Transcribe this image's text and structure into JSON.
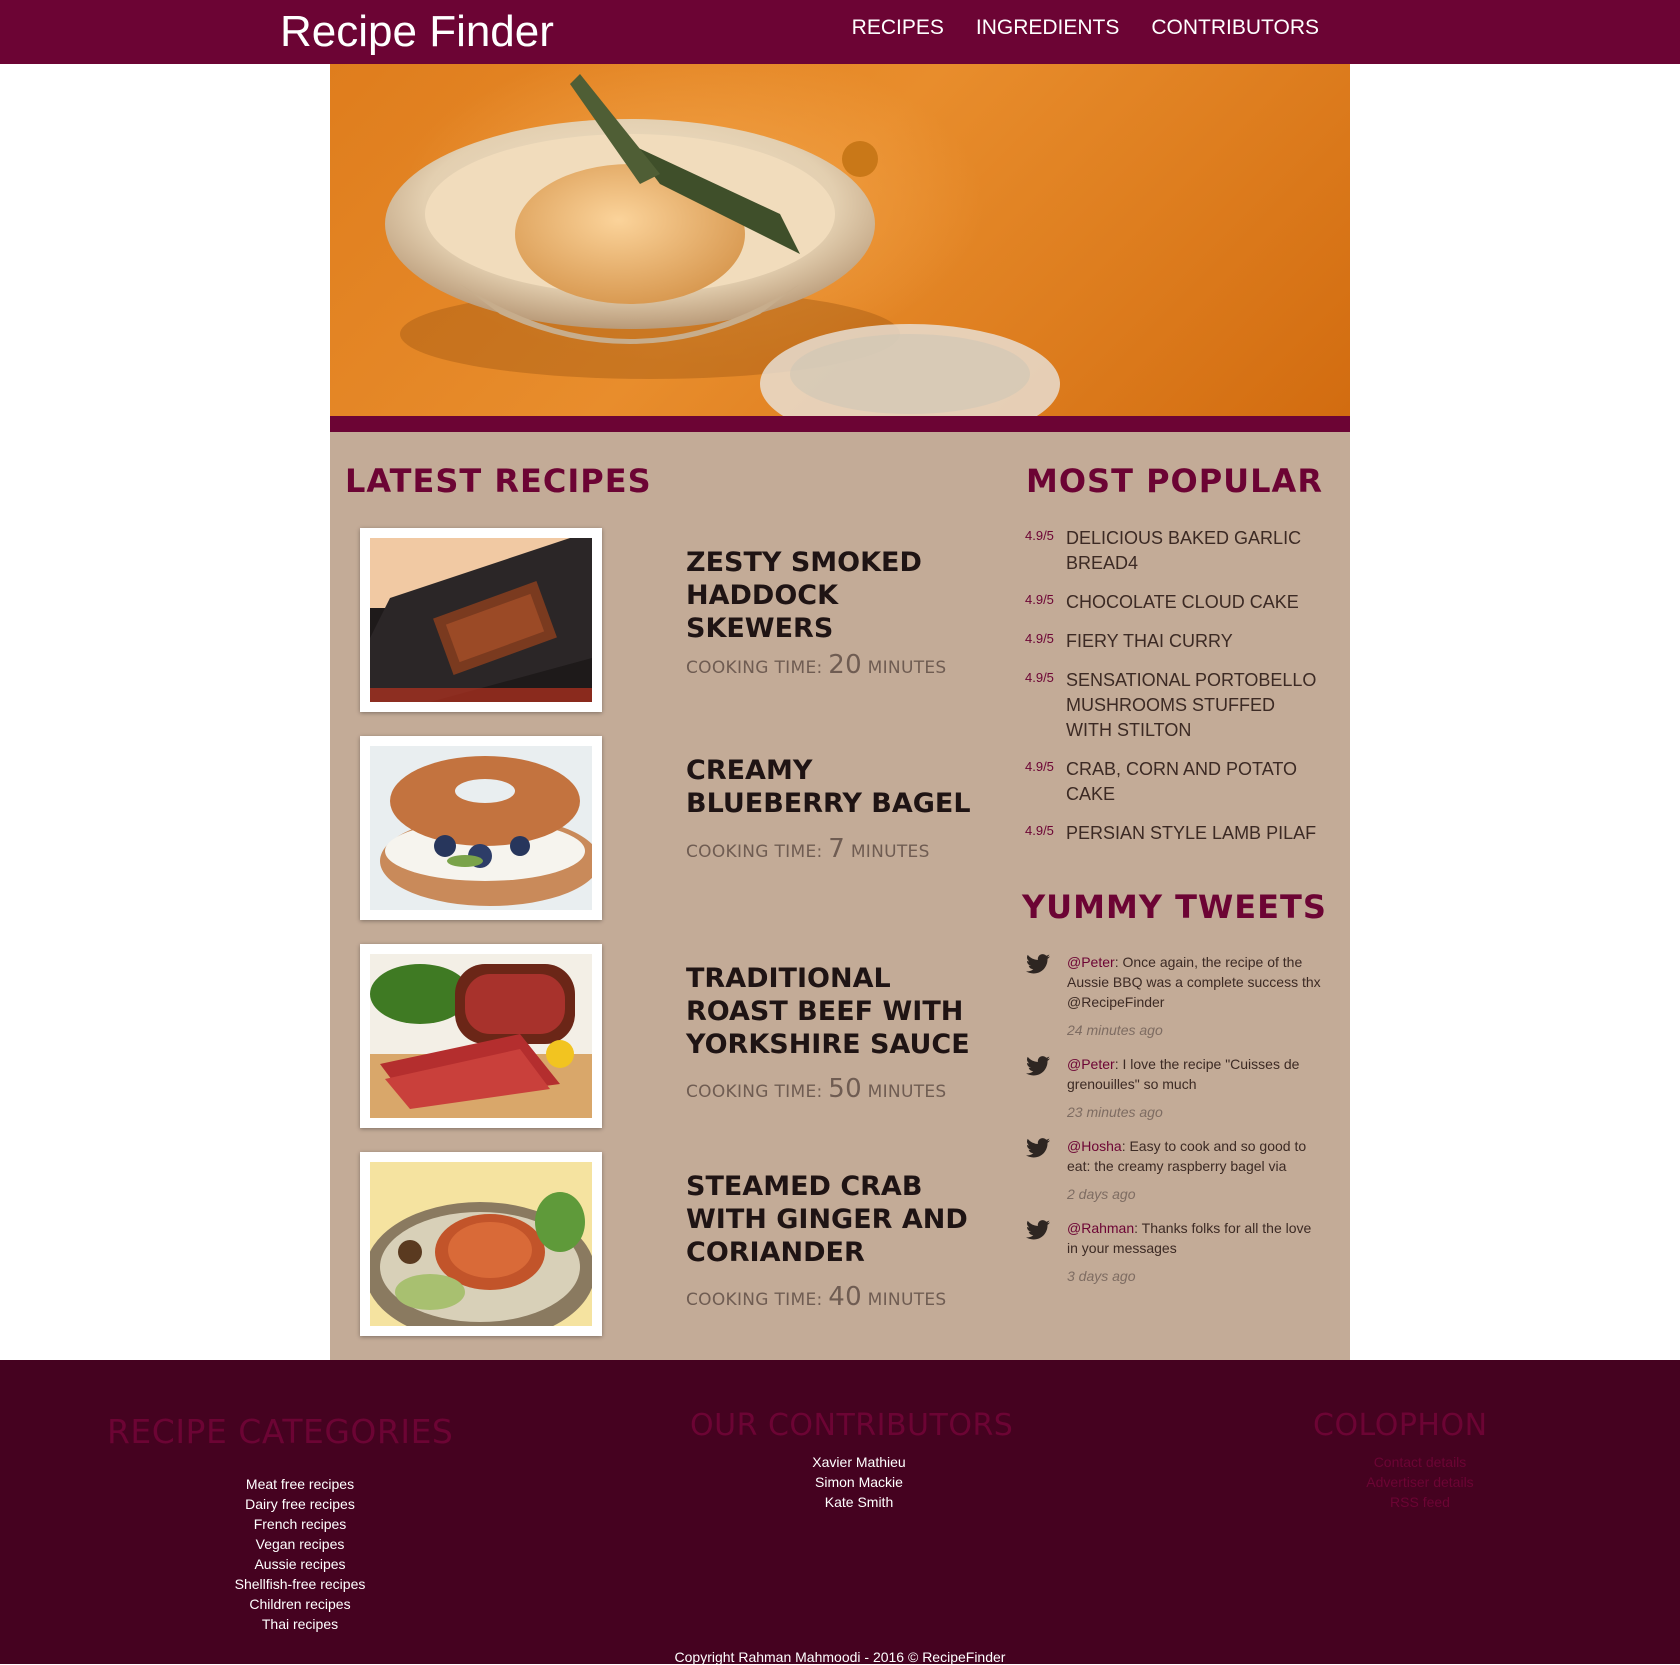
{
  "header": {
    "logo": "Recipe Finder",
    "nav": [
      "RECIPES",
      "INGREDIENTS",
      "CONTRIBUTORS"
    ]
  },
  "latest": {
    "title": "LATEST RECIPES",
    "cooking_label": "COOKING TIME:",
    "minutes_label": "MINUTES",
    "items": [
      {
        "title": "ZESTY SMOKED HADDOCK SKEWERS",
        "time": "20"
      },
      {
        "title": "CREAMY BLUEBERRY BAGEL",
        "time": "7"
      },
      {
        "title": "TRADITIONAL ROAST BEEF WITH YORKSHIRE SAUCE",
        "time": "50"
      },
      {
        "title": "STEAMED CRAB WITH GINGER AND CORIANDER",
        "time": "40"
      }
    ]
  },
  "popular": {
    "title": "MOST POPULAR",
    "items": [
      {
        "rating": "4.9/5",
        "name": "DELICIOUS BAKED GARLIC BREAD4"
      },
      {
        "rating": "4.9/5",
        "name": "CHOCOLATE CLOUD CAKE"
      },
      {
        "rating": "4.9/5",
        "name": "FIERY THAI CURRY"
      },
      {
        "rating": "4.9/5",
        "name": "SENSATIONAL PORTOBELLO MUSHROOMS STUFFED WITH STILTON"
      },
      {
        "rating": "4.9/5",
        "name": "CRAB, CORN AND POTATO CAKE"
      },
      {
        "rating": "4.9/5",
        "name": "PERSIAN STYLE LAMB PILAF"
      }
    ]
  },
  "tweets": {
    "title": "YUMMY TWEETS",
    "items": [
      {
        "user": "@Peter",
        "text": ": Once again, the recipe of the Aussie BBQ was a complete success thx @RecipeFinder",
        "time": "24 minutes ago"
      },
      {
        "user": "@Peter",
        "text": ": I love the recipe \"Cuisses de grenouilles\" so much",
        "time": "23 minutes ago"
      },
      {
        "user": "@Hosha",
        "text": ": Easy to cook and so good to eat: the creamy raspberry bagel via",
        "time": "2 days ago"
      },
      {
        "user": "@Rahman",
        "text": ": Thanks folks for all the love in your messages",
        "time": "3 days ago"
      }
    ]
  },
  "footer": {
    "categories": {
      "title": "RECIPE CATEGORIES",
      "links": [
        "Meat free recipes",
        "Dairy free recipes",
        "French recipes",
        "Vegan recipes",
        "Aussie recipes",
        "Shellfish-free recipes",
        "Children recipes",
        "Thai recipes"
      ]
    },
    "contributors": {
      "title": "OUR CONTRIBUTORS",
      "links": [
        "Xavier Mathieu",
        "Simon Mackie",
        "Kate Smith"
      ]
    },
    "colophon": {
      "title": "COLOPHON",
      "links": [
        "Contact details",
        "Advertiser details",
        "RSS feed"
      ]
    },
    "copyright": "Copyright Rahman Mahmoodi - 2016 © RecipeFinder"
  }
}
